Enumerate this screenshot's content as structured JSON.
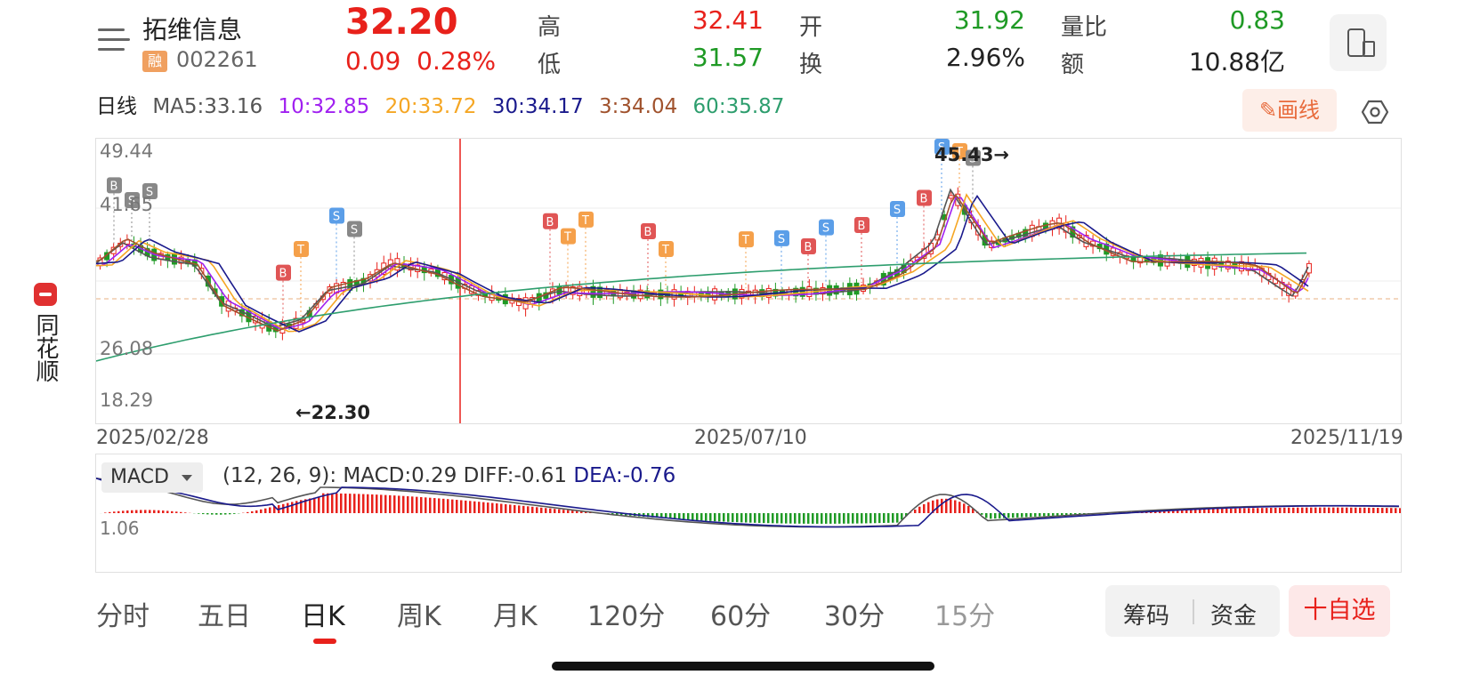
{
  "app": {
    "side_label": "同花顺"
  },
  "header": {
    "stock_name": "拓维信息",
    "margin_badge": "融",
    "stock_code": "002261",
    "price": "32.20",
    "change": "0.09",
    "change_pct": "0.28%",
    "stats": [
      {
        "label": "高",
        "value": "32.41",
        "color": "red"
      },
      {
        "label": "开",
        "value": "31.92",
        "color": "green"
      },
      {
        "label": "量比",
        "value": "0.83",
        "color": "green"
      },
      {
        "label": "低",
        "value": "31.57",
        "color": "green"
      },
      {
        "label": "换",
        "value": "2.96%",
        "color": "dark"
      },
      {
        "label": "额",
        "value": "10.88亿",
        "color": "dark"
      }
    ]
  },
  "ma_bar": {
    "period": "日线",
    "ma5": "MA5:33.16",
    "ma10": "10:32.85",
    "ma20": "20:33.72",
    "ma30": "30:34.17",
    "ma3": "3:34.04",
    "ma60": "60:35.87",
    "colors": {
      "ma5": "#555555",
      "ma10": "#a020f0",
      "ma20": "#f5a623",
      "ma30": "#1a1a8c",
      "ma3": "#a0522d",
      "ma60": "#2e9e6e"
    },
    "draw_button": "画线"
  },
  "kline": {
    "y_labels": [
      "49.44",
      "41.65",
      "26.08",
      "18.29"
    ],
    "high_label": "45.43→",
    "low_label": "←22.30",
    "dates": [
      "2025/02/28",
      "2025/07/10",
      "2025/11/19"
    ]
  },
  "macd": {
    "indicator": "MACD",
    "params": "(12, 26, 9):",
    "macd_val": "MACD:0.29",
    "diff_val": "DIFF:-0.61",
    "dea_val": "DEA:-0.76",
    "y_label": "1.06"
  },
  "tabs": [
    "分时",
    "五日",
    "日K",
    "周K",
    "月K",
    "120分",
    "60分",
    "30分",
    "15分"
  ],
  "active_tab": "日K",
  "bottom": {
    "chip_1": "筹码",
    "chip_2": "资金",
    "add_watch": "十自选"
  },
  "colors": {
    "up": "#e8211b",
    "down": "#1f9a25",
    "accent": "#e86b3c"
  }
}
